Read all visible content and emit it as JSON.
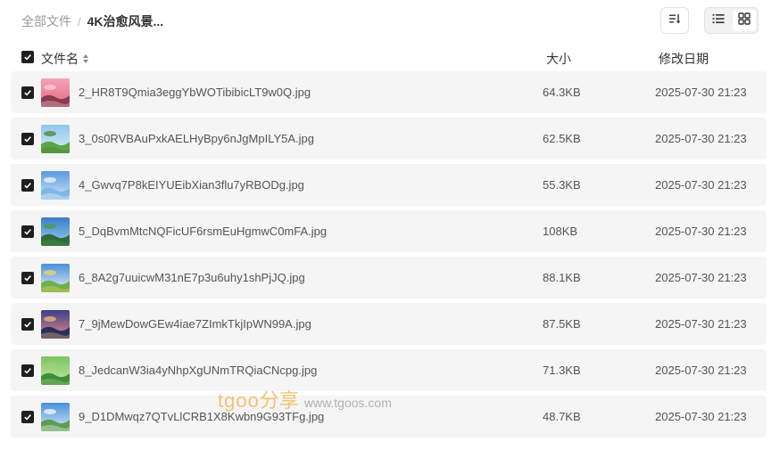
{
  "breadcrumb": {
    "root": "全部文件",
    "separator": "/",
    "current": "4K治愈风景..."
  },
  "toolbar": {
    "sort_icon": "sort-icon",
    "list_view_icon": "list-view-icon",
    "grid_view_icon": "grid-view-icon",
    "active_view": "list"
  },
  "table": {
    "columns": {
      "name": "文件名",
      "size": "大小",
      "date": "修改日期"
    },
    "select_all_checked": true,
    "rows": [
      {
        "name": "2_HR8T9Qmia3eggYbWOTibibicLT9w0Q.jpg",
        "size": "64.3KB",
        "date": "2025-07-30 21:23",
        "checked": true,
        "thumb": "pink-sunset"
      },
      {
        "name": "3_0s0RVBAuPxkAELHyBpy6nJgMpILY5A.jpg",
        "size": "62.5KB",
        "date": "2025-07-30 21:23",
        "checked": true,
        "thumb": "green-hills"
      },
      {
        "name": "4_Gwvq7P8kEIYUEibXian3flu7yRBODg.jpg",
        "size": "55.3KB",
        "date": "2025-07-30 21:23",
        "checked": true,
        "thumb": "blue-lake"
      },
      {
        "name": "5_DqBvmMtcNQFicUF6rsmEuHgmwC0mFA.jpg",
        "size": "108KB",
        "date": "2025-07-30 21:23",
        "checked": true,
        "thumb": "forest-sky"
      },
      {
        "name": "6_8A2g7uuicwM31nE7p3u6uhy1shPjJQ.jpg",
        "size": "88.1KB",
        "date": "2025-07-30 21:23",
        "checked": true,
        "thumb": "meadow-clouds"
      },
      {
        "name": "7_9jMewDowGEw4iae7ZImkTkjIpWN99A.jpg",
        "size": "87.5KB",
        "date": "2025-07-30 21:23",
        "checked": true,
        "thumb": "purple-dusk"
      },
      {
        "name": "8_JedcanW3ia4yNhpXgUNmTRQiaCNcpg.jpg",
        "size": "71.3KB",
        "date": "2025-07-30 21:23",
        "checked": true,
        "thumb": "green-garden"
      },
      {
        "name": "9_D1DMwqz7QTvLlCRB1X8Kwbn9G93TFg.jpg",
        "size": "48.7KB",
        "date": "2025-07-30 21:23",
        "checked": true,
        "thumb": "sky-clouds"
      }
    ]
  },
  "watermark": {
    "brand": "tgoo",
    "brand_cn": "分享",
    "url": "www.tgoos.com"
  },
  "colors": {
    "row_bg": "#f5f5f5",
    "checkbox": "#1f1f1f",
    "text_muted": "#999999",
    "watermark_orange": "#f2b24a"
  }
}
